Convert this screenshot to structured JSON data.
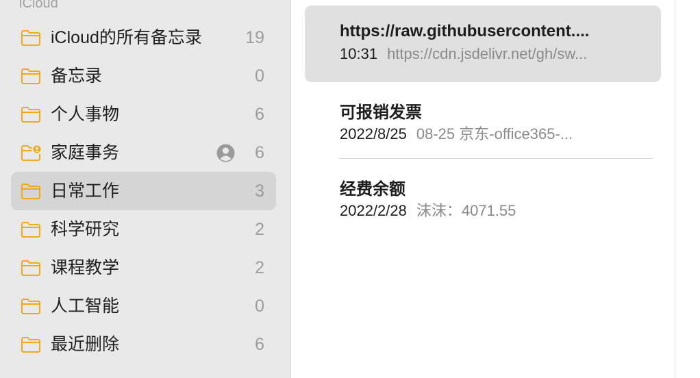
{
  "sidebar": {
    "section_header": "iCloud",
    "folders": [
      {
        "label": "iCloud的所有备忘录",
        "count": "19"
      },
      {
        "label": "备忘录",
        "count": "0"
      },
      {
        "label": "个人事物",
        "count": "6"
      },
      {
        "label": "家庭事务",
        "count": "6",
        "shared": true
      },
      {
        "label": "日常工作",
        "count": "3",
        "selected": true
      },
      {
        "label": "科学研究",
        "count": "2"
      },
      {
        "label": "课程教学",
        "count": "2"
      },
      {
        "label": "人工智能",
        "count": "0"
      },
      {
        "label": "最近删除",
        "count": "6"
      }
    ]
  },
  "notes": [
    {
      "title": "https://raw.githubusercontent....",
      "date": "10:31",
      "preview": "https://cdn.jsdelivr.net/gh/sw...",
      "selected": true
    },
    {
      "title": "可报销发票",
      "date": "2022/8/25",
      "preview": "08-25 京东-office365-..."
    },
    {
      "title": "经费余额",
      "date": "2022/2/28",
      "preview": "沫沫：4071.55"
    }
  ],
  "colors": {
    "folder_icon": "#f0a91f",
    "sidebar_bg": "#e9e9e9",
    "selection": "#d5d5d5",
    "shared_badge": "#f0a91f"
  },
  "icons": {
    "folder": "folder-icon",
    "shared_folder": "shared-folder-icon",
    "person": "person-icon"
  }
}
